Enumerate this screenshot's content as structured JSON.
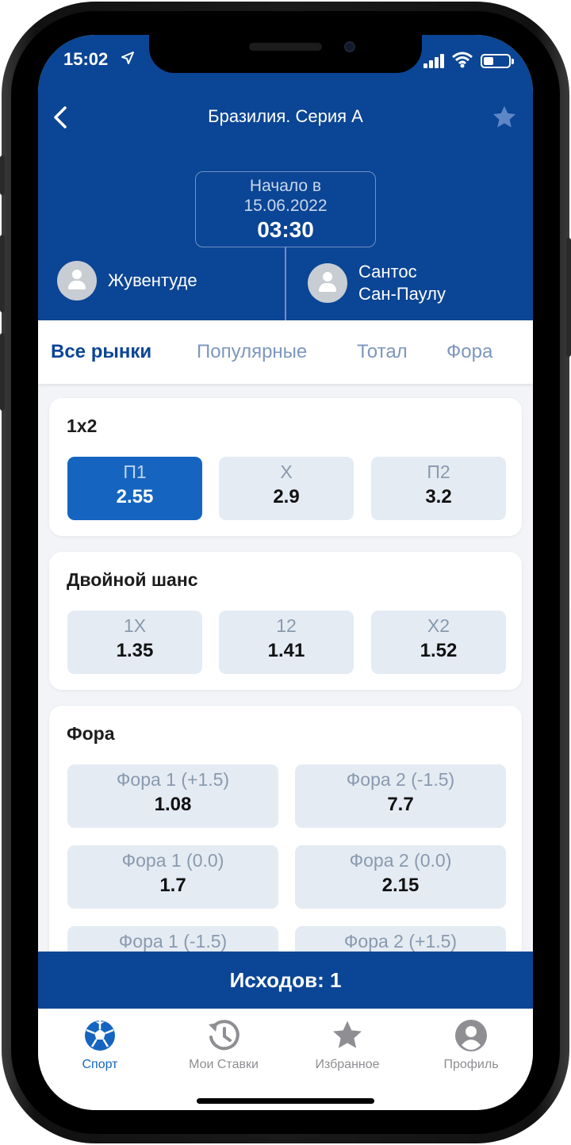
{
  "status_bar": {
    "time": "15:02",
    "location_icon": "location-arrow-icon"
  },
  "nav": {
    "back_icon": "chevron-left-icon",
    "title": "Бразилия. Серия А",
    "favorite_icon": "star-icon"
  },
  "match": {
    "start_label": "Начало в",
    "date": "15.06.2022",
    "time": "03:30",
    "team1": "Жувентуде",
    "team2_line1": "Сантос",
    "team2_line2": "Сан-Паулу"
  },
  "tabs": [
    "Все рынки",
    "Популярные",
    "Тотал",
    "Фора"
  ],
  "markets": {
    "m1x2": {
      "title": "1x2",
      "odds": [
        {
          "label": "П1",
          "value": "2.55",
          "selected": true
        },
        {
          "label": "X",
          "value": "2.9"
        },
        {
          "label": "П2",
          "value": "3.2"
        }
      ]
    },
    "double": {
      "title": "Двойной шанс",
      "odds": [
        {
          "label": "1X",
          "value": "1.35"
        },
        {
          "label": "12",
          "value": "1.41"
        },
        {
          "label": "X2",
          "value": "1.52"
        }
      ]
    },
    "handicap": {
      "title": "Фора",
      "odds": [
        {
          "label": "Фора 1 (+1.5)",
          "value": "1.08"
        },
        {
          "label": "Фора 2 (-1.5)",
          "value": "7.7"
        },
        {
          "label": "Фора 1 (0.0)",
          "value": "1.7"
        },
        {
          "label": "Фора 2 (0.0)",
          "value": "2.15"
        },
        {
          "label": "Фора 1 (-1.5)",
          "value": ""
        },
        {
          "label": "Фора 2 (+1.5)",
          "value": ""
        }
      ]
    }
  },
  "betslip": {
    "label": "Исходов: 1"
  },
  "tabbar": [
    {
      "label": "Спорт",
      "icon": "soccer-ball-icon",
      "active": true
    },
    {
      "label": "Мои Ставки",
      "icon": "history-icon"
    },
    {
      "label": "Избранное",
      "icon": "star-icon"
    },
    {
      "label": "Профиль",
      "icon": "user-icon"
    }
  ],
  "colors": {
    "primary": "#0b4595",
    "accent": "#1565c0",
    "odd_bg": "#e4ebf3"
  }
}
